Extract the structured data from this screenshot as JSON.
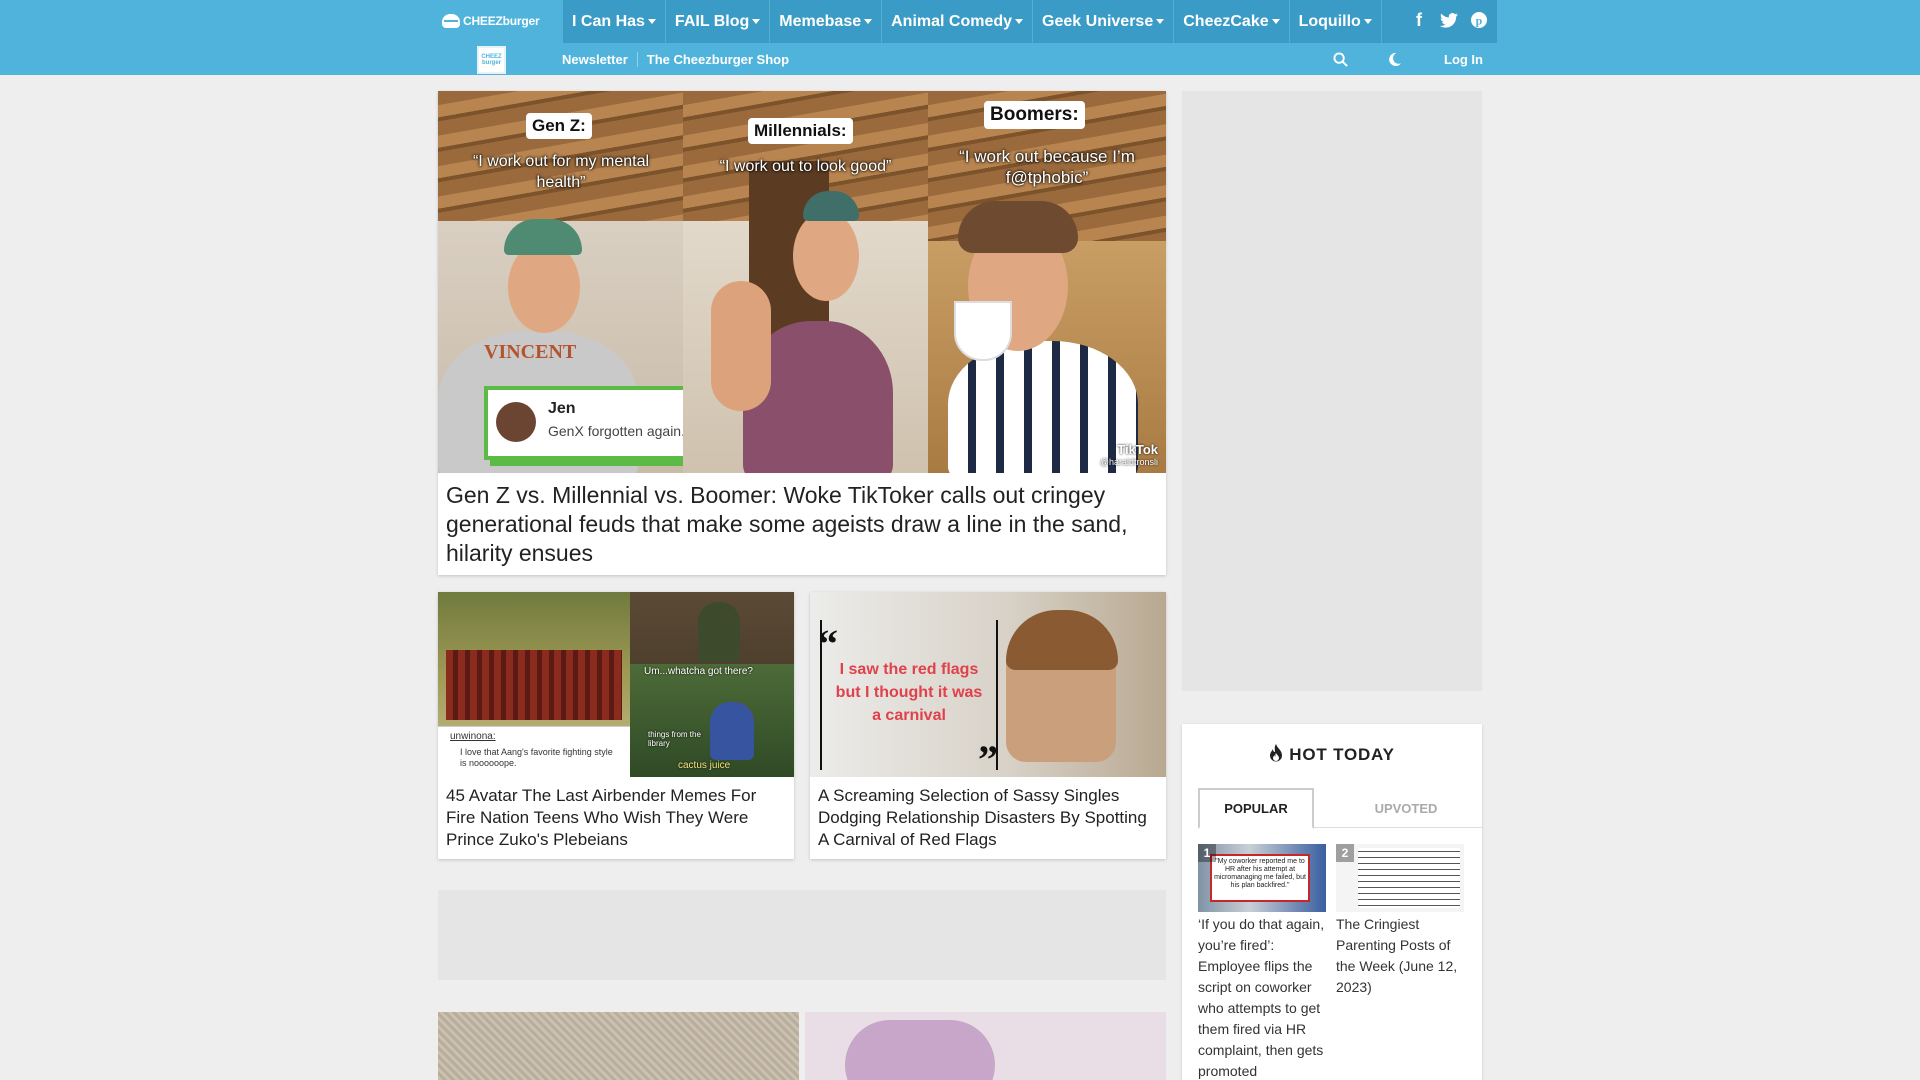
{
  "header": {
    "logo_text": "CHEEZburger",
    "small_logo_text": "CHEEZ burger",
    "menu": [
      {
        "label": "I Can Has"
      },
      {
        "label": "FAIL Blog"
      },
      {
        "label": "Memebase"
      },
      {
        "label": "Animal Comedy"
      },
      {
        "label": "Geek Universe"
      },
      {
        "label": "CheezCake"
      },
      {
        "label": "Loquillo"
      }
    ],
    "social_icons": [
      "facebook-icon",
      "twitter-icon",
      "pinterest-icon"
    ],
    "sub_links": [
      {
        "label": "Newsletter"
      },
      {
        "label": "The Cheezburger Shop"
      }
    ],
    "login_label": "Log In"
  },
  "feature": {
    "title": "Gen Z vs. Millennial vs. Boomer: Woke TikToker calls out cringey generational feuds that make some ageists draw a line in the sand, hilarity ensues",
    "panels": [
      {
        "tag": "Gen Z:",
        "quote": "“I work out for my mental health”"
      },
      {
        "tag": "Millennials:",
        "quote": "“I work out to look good”"
      },
      {
        "tag": "Boomers:",
        "quote": "“I work out because I’m f@tphobic”"
      }
    ],
    "comment_name": "Jen",
    "comment_text": "GenX forgotten again. 😂",
    "watermark": "TikTok",
    "watermark_handle": "@haraldtronsli",
    "shirt_text": "VINCENT"
  },
  "cards": [
    {
      "title": "45 Avatar The Last Airbender Memes For Fire Nation Teens Who Wish They Were Prince Zuko's Plebeians",
      "img_texts": {
        "user": "unwinona:",
        "post": "I love that Aang's favorite fighting style is noooooope.",
        "caption1": "Um...whatcha got there?",
        "caption2": "things from the library",
        "caption3": "cactus juice"
      }
    },
    {
      "title": "A Screaming Selection of Sassy Singles Dodging Relationship Disasters By Spotting A Carnival of Red Flags",
      "img_quote": "I saw the red flags but I thought it was a carnival"
    }
  ],
  "sidebar": {
    "hot_title": "HOT TODAY",
    "tabs": [
      {
        "label": "POPULAR",
        "active": true
      },
      {
        "label": "UPVOTED",
        "active": false
      }
    ],
    "items": [
      {
        "rank": "1",
        "title": "‘If you do that again, you’re fired’: Employee flips the script on coworker who attempts to get them fired via HR complaint, then gets promoted",
        "thumb_text": "\"My coworker reported me to HR after his attempt at micromanaging me failed, but his plan backfired.\""
      },
      {
        "rank": "2",
        "title": "The Cringiest Parenting Posts of the Week (June 12, 2023)"
      }
    ]
  },
  "colors": {
    "header_bg": "#4fb3dc",
    "header_dark": "#3a9cc6",
    "page_bg": "#eeeeee",
    "accent_green": "#5bbb45",
    "quote_red": "#e0414a"
  }
}
